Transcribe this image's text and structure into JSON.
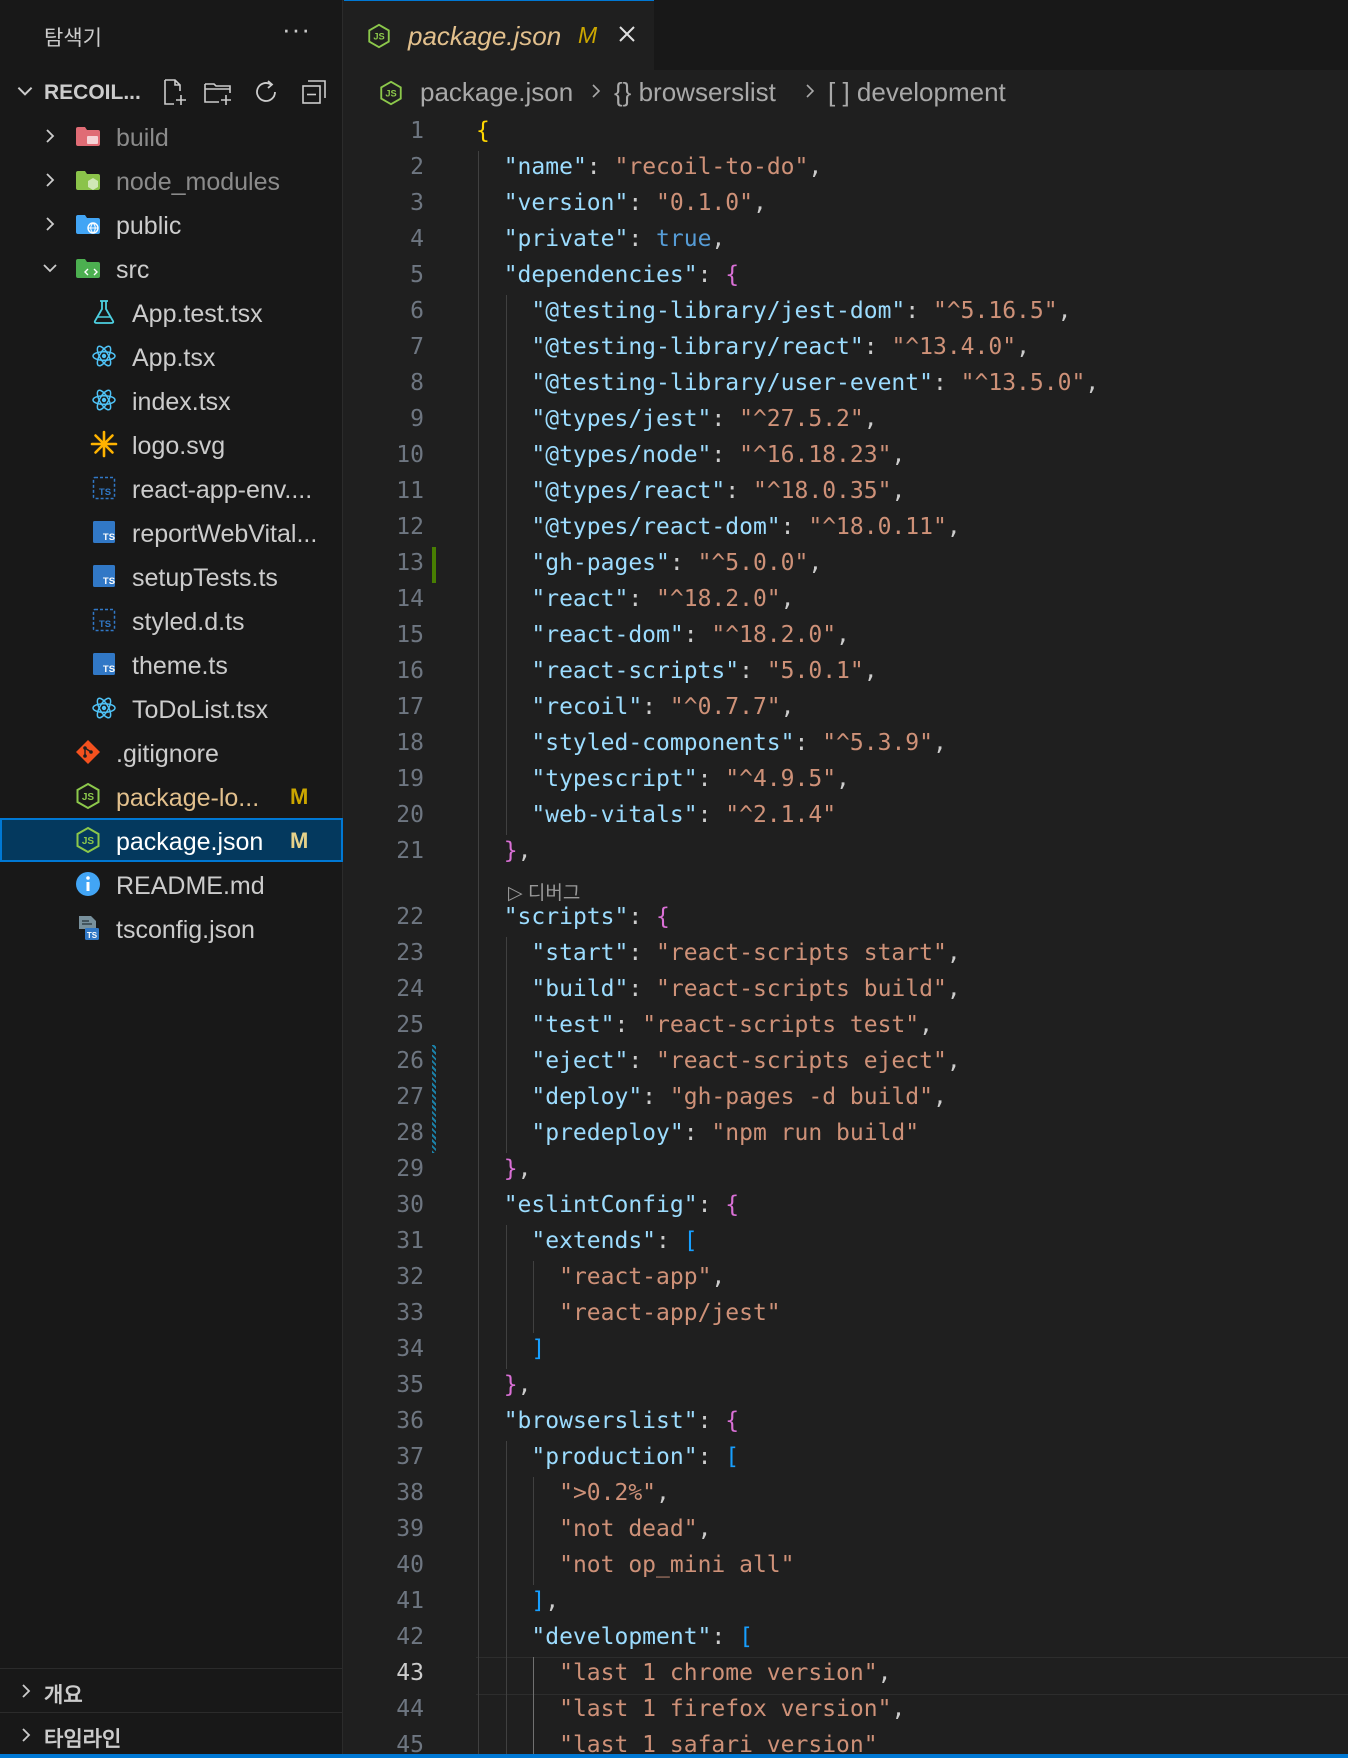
{
  "sidebar": {
    "title": "탐색기",
    "more": "···",
    "project": "RECOIL...",
    "tree": [
      {
        "label": "build",
        "depth": 0,
        "type": "folder",
        "icon": "folder-build-icon",
        "color": "#e06c75",
        "expanded": false,
        "dim": true
      },
      {
        "label": "node_modules",
        "depth": 0,
        "type": "folder",
        "icon": "folder-node-icon",
        "color": "#8bc34a",
        "expanded": false,
        "dim": true
      },
      {
        "label": "public",
        "depth": 0,
        "type": "folder",
        "icon": "folder-public-icon",
        "color": "#42a5f5",
        "expanded": false
      },
      {
        "label": "src",
        "depth": 0,
        "type": "folder",
        "icon": "folder-src-icon",
        "color": "#4caf50",
        "expanded": true
      },
      {
        "label": "App.test.tsx",
        "depth": 1,
        "type": "file",
        "icon": "flask-icon"
      },
      {
        "label": "App.tsx",
        "depth": 1,
        "type": "file",
        "icon": "react-icon"
      },
      {
        "label": "index.tsx",
        "depth": 1,
        "type": "file",
        "icon": "react-icon"
      },
      {
        "label": "logo.svg",
        "depth": 1,
        "type": "file",
        "icon": "svg-icon"
      },
      {
        "label": "react-app-env....",
        "depth": 1,
        "type": "file",
        "icon": "ts-def-icon"
      },
      {
        "label": "reportWebVital...",
        "depth": 1,
        "type": "file",
        "icon": "ts-icon"
      },
      {
        "label": "setupTests.ts",
        "depth": 1,
        "type": "file",
        "icon": "ts-icon"
      },
      {
        "label": "styled.d.ts",
        "depth": 1,
        "type": "file",
        "icon": "ts-def-icon"
      },
      {
        "label": "theme.ts",
        "depth": 1,
        "type": "file",
        "icon": "ts-icon"
      },
      {
        "label": "ToDoList.tsx",
        "depth": 1,
        "type": "file",
        "icon": "react-icon"
      },
      {
        "label": ".gitignore",
        "depth": 0,
        "type": "file",
        "icon": "git-icon"
      },
      {
        "label": "package-lo...",
        "depth": 0,
        "type": "file",
        "icon": "nodejs-icon",
        "badge": "M",
        "modified": true
      },
      {
        "label": "package.json",
        "depth": 0,
        "type": "file",
        "icon": "nodejs-icon",
        "badge": "M",
        "selected": true
      },
      {
        "label": "README.md",
        "depth": 0,
        "type": "file",
        "icon": "info-icon"
      },
      {
        "label": "tsconfig.json",
        "depth": 0,
        "type": "file",
        "icon": "tsconfig-icon"
      }
    ],
    "panels": [
      "개요",
      "타임라인"
    ]
  },
  "tab": {
    "title": "package.json",
    "badge": "M"
  },
  "breadcrumb": [
    "package.json",
    "{} browserslist",
    "[ ] development"
  ],
  "codelens": "▷ 디버그",
  "current_line": 43,
  "colors": {
    "accent": "#0078d4",
    "modified": "#cca700",
    "added_gutter": "#487e02"
  },
  "code_lines": [
    [
      [
        "{",
        "b1"
      ]
    ],
    [
      [
        "  ",
        ""
      ],
      [
        "\"name\"",
        "k"
      ],
      [
        ": ",
        "p"
      ],
      [
        "\"recoil-to-do\"",
        "s"
      ],
      [
        ",",
        "p"
      ]
    ],
    [
      [
        "  ",
        ""
      ],
      [
        "\"version\"",
        "k"
      ],
      [
        ": ",
        "p"
      ],
      [
        "\"0.1.0\"",
        "s"
      ],
      [
        ",",
        "p"
      ]
    ],
    [
      [
        "  ",
        ""
      ],
      [
        "\"private\"",
        "k"
      ],
      [
        ": ",
        "p"
      ],
      [
        "true",
        "kw"
      ],
      [
        ",",
        "p"
      ]
    ],
    [
      [
        "  ",
        ""
      ],
      [
        "\"dependencies\"",
        "k"
      ],
      [
        ": ",
        "p"
      ],
      [
        "{",
        "b2"
      ]
    ],
    [
      [
        "    ",
        ""
      ],
      [
        "\"@testing-library/jest-dom\"",
        "k"
      ],
      [
        ": ",
        "p"
      ],
      [
        "\"^5.16.5\"",
        "s"
      ],
      [
        ",",
        "p"
      ]
    ],
    [
      [
        "    ",
        ""
      ],
      [
        "\"@testing-library/react\"",
        "k"
      ],
      [
        ": ",
        "p"
      ],
      [
        "\"^13.4.0\"",
        "s"
      ],
      [
        ",",
        "p"
      ]
    ],
    [
      [
        "    ",
        ""
      ],
      [
        "\"@testing-library/user-event\"",
        "k"
      ],
      [
        ": ",
        "p"
      ],
      [
        "\"^13.5.0\"",
        "s"
      ],
      [
        ",",
        "p"
      ]
    ],
    [
      [
        "    ",
        ""
      ],
      [
        "\"@types/jest\"",
        "k"
      ],
      [
        ": ",
        "p"
      ],
      [
        "\"^27.5.2\"",
        "s"
      ],
      [
        ",",
        "p"
      ]
    ],
    [
      [
        "    ",
        ""
      ],
      [
        "\"@types/node\"",
        "k"
      ],
      [
        ": ",
        "p"
      ],
      [
        "\"^16.18.23\"",
        "s"
      ],
      [
        ",",
        "p"
      ]
    ],
    [
      [
        "    ",
        ""
      ],
      [
        "\"@types/react\"",
        "k"
      ],
      [
        ": ",
        "p"
      ],
      [
        "\"^18.0.35\"",
        "s"
      ],
      [
        ",",
        "p"
      ]
    ],
    [
      [
        "    ",
        ""
      ],
      [
        "\"@types/react-dom\"",
        "k"
      ],
      [
        ": ",
        "p"
      ],
      [
        "\"^18.0.11\"",
        "s"
      ],
      [
        ",",
        "p"
      ]
    ],
    [
      [
        "    ",
        ""
      ],
      [
        "\"gh-pages\"",
        "k"
      ],
      [
        ": ",
        "p"
      ],
      [
        "\"^5.0.0\"",
        "s"
      ],
      [
        ",",
        "p"
      ]
    ],
    [
      [
        "    ",
        ""
      ],
      [
        "\"react\"",
        "k"
      ],
      [
        ": ",
        "p"
      ],
      [
        "\"^18.2.0\"",
        "s"
      ],
      [
        ",",
        "p"
      ]
    ],
    [
      [
        "    ",
        ""
      ],
      [
        "\"react-dom\"",
        "k"
      ],
      [
        ": ",
        "p"
      ],
      [
        "\"^18.2.0\"",
        "s"
      ],
      [
        ",",
        "p"
      ]
    ],
    [
      [
        "    ",
        ""
      ],
      [
        "\"react-scripts\"",
        "k"
      ],
      [
        ": ",
        "p"
      ],
      [
        "\"5.0.1\"",
        "s"
      ],
      [
        ",",
        "p"
      ]
    ],
    [
      [
        "    ",
        ""
      ],
      [
        "\"recoil\"",
        "k"
      ],
      [
        ": ",
        "p"
      ],
      [
        "\"^0.7.7\"",
        "s"
      ],
      [
        ",",
        "p"
      ]
    ],
    [
      [
        "    ",
        ""
      ],
      [
        "\"styled-components\"",
        "k"
      ],
      [
        ": ",
        "p"
      ],
      [
        "\"^5.3.9\"",
        "s"
      ],
      [
        ",",
        "p"
      ]
    ],
    [
      [
        "    ",
        ""
      ],
      [
        "\"typescript\"",
        "k"
      ],
      [
        ": ",
        "p"
      ],
      [
        "\"^4.9.5\"",
        "s"
      ],
      [
        ",",
        "p"
      ]
    ],
    [
      [
        "    ",
        ""
      ],
      [
        "\"web-vitals\"",
        "k"
      ],
      [
        ": ",
        "p"
      ],
      [
        "\"^2.1.4\"",
        "s"
      ]
    ],
    [
      [
        "  ",
        ""
      ],
      [
        "}",
        "b2"
      ],
      [
        ",",
        "p"
      ]
    ],
    [
      [
        "  ",
        ""
      ],
      [
        "\"scripts\"",
        "k"
      ],
      [
        ": ",
        "p"
      ],
      [
        "{",
        "b2"
      ]
    ],
    [
      [
        "    ",
        ""
      ],
      [
        "\"start\"",
        "k"
      ],
      [
        ": ",
        "p"
      ],
      [
        "\"react-scripts start\"",
        "s"
      ],
      [
        ",",
        "p"
      ]
    ],
    [
      [
        "    ",
        ""
      ],
      [
        "\"build\"",
        "k"
      ],
      [
        ": ",
        "p"
      ],
      [
        "\"react-scripts build\"",
        "s"
      ],
      [
        ",",
        "p"
      ]
    ],
    [
      [
        "    ",
        ""
      ],
      [
        "\"test\"",
        "k"
      ],
      [
        ": ",
        "p"
      ],
      [
        "\"react-scripts test\"",
        "s"
      ],
      [
        ",",
        "p"
      ]
    ],
    [
      [
        "    ",
        ""
      ],
      [
        "\"eject\"",
        "k"
      ],
      [
        ": ",
        "p"
      ],
      [
        "\"react-scripts eject\"",
        "s"
      ],
      [
        ",",
        "p"
      ]
    ],
    [
      [
        "    ",
        ""
      ],
      [
        "\"deploy\"",
        "k"
      ],
      [
        ": ",
        "p"
      ],
      [
        "\"gh-pages -d build\"",
        "s"
      ],
      [
        ",",
        "p"
      ]
    ],
    [
      [
        "    ",
        ""
      ],
      [
        "\"predeploy\"",
        "k"
      ],
      [
        ": ",
        "p"
      ],
      [
        "\"npm run build\"",
        "s"
      ]
    ],
    [
      [
        "  ",
        ""
      ],
      [
        "}",
        "b2"
      ],
      [
        ",",
        "p"
      ]
    ],
    [
      [
        "  ",
        ""
      ],
      [
        "\"eslintConfig\"",
        "k"
      ],
      [
        ": ",
        "p"
      ],
      [
        "{",
        "b2"
      ]
    ],
    [
      [
        "    ",
        ""
      ],
      [
        "\"extends\"",
        "k"
      ],
      [
        ": ",
        "p"
      ],
      [
        "[",
        "b3"
      ]
    ],
    [
      [
        "      ",
        ""
      ],
      [
        "\"react-app\"",
        "s"
      ],
      [
        ",",
        "p"
      ]
    ],
    [
      [
        "      ",
        ""
      ],
      [
        "\"react-app/jest\"",
        "s"
      ]
    ],
    [
      [
        "    ",
        ""
      ],
      [
        "]",
        "b3"
      ]
    ],
    [
      [
        "  ",
        ""
      ],
      [
        "}",
        "b2"
      ],
      [
        ",",
        "p"
      ]
    ],
    [
      [
        "  ",
        ""
      ],
      [
        "\"browserslist\"",
        "k"
      ],
      [
        ": ",
        "p"
      ],
      [
        "{",
        "b2"
      ]
    ],
    [
      [
        "    ",
        ""
      ],
      [
        "\"production\"",
        "k"
      ],
      [
        ": ",
        "p"
      ],
      [
        "[",
        "b3"
      ]
    ],
    [
      [
        "      ",
        ""
      ],
      [
        "\">0.2%\"",
        "s"
      ],
      [
        ",",
        "p"
      ]
    ],
    [
      [
        "      ",
        ""
      ],
      [
        "\"not dead\"",
        "s"
      ],
      [
        ",",
        "p"
      ]
    ],
    [
      [
        "      ",
        ""
      ],
      [
        "\"not op_mini all\"",
        "s"
      ]
    ],
    [
      [
        "    ",
        ""
      ],
      [
        "]",
        "b3"
      ],
      [
        ",",
        "p"
      ]
    ],
    [
      [
        "    ",
        ""
      ],
      [
        "\"development\"",
        "k"
      ],
      [
        ": ",
        "p"
      ],
      [
        "[",
        "b3"
      ]
    ],
    [
      [
        "      ",
        ""
      ],
      [
        "\"last 1 chrome version\"",
        "s"
      ],
      [
        ",",
        "p"
      ]
    ],
    [
      [
        "      ",
        ""
      ],
      [
        "\"last 1 firefox version\"",
        "s"
      ],
      [
        ",",
        "p"
      ]
    ],
    [
      [
        "      ",
        ""
      ],
      [
        "\"last 1 safari version\"",
        "s"
      ]
    ]
  ]
}
